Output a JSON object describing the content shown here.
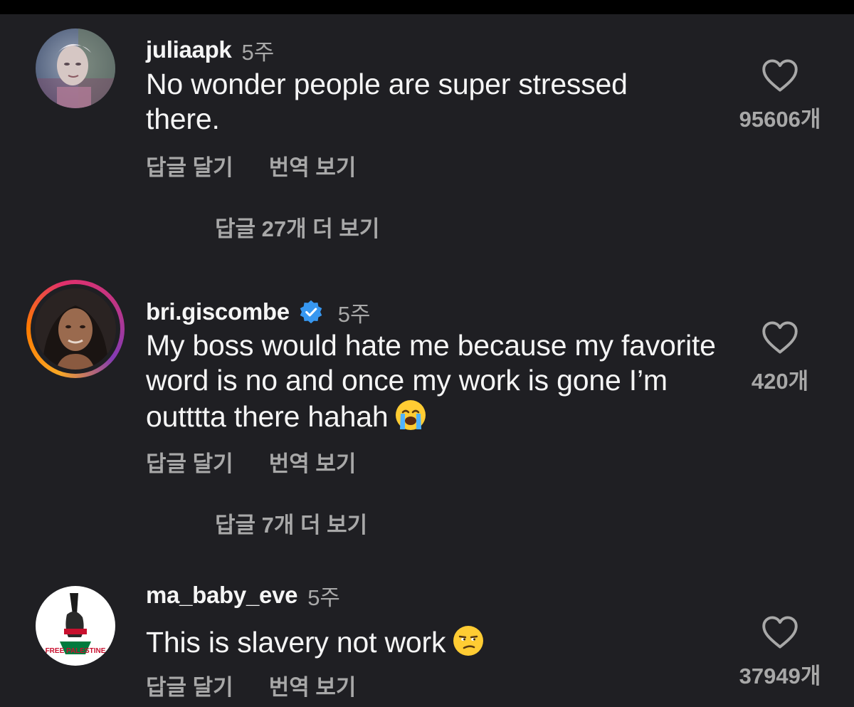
{
  "comments": [
    {
      "username": "juliaapk",
      "verified": false,
      "time": "5주",
      "text": "No wonder people are super stressed there.",
      "emoji": "",
      "reply_label": "답글 달기",
      "translate_label": "번역 보기",
      "like_count": "95606개",
      "more_replies": "답글 27개 더 보기"
    },
    {
      "username": "bri.giscombe",
      "verified": true,
      "time": "5주",
      "text": "My boss would hate me because my favorite word is no and once my work is gone I’m outttta there hahah",
      "emoji": "loudly-crying-face",
      "reply_label": "답글 달기",
      "translate_label": "번역 보기",
      "like_count": "420개",
      "more_replies": "답글 7개 더 보기"
    },
    {
      "username": "ma_baby_eve",
      "verified": false,
      "time": "5주",
      "text": "This is slavery not work",
      "emoji": "unamused-face",
      "reply_label": "답글 달기",
      "translate_label": "번역 보기",
      "like_count": "37949개",
      "avatar_text": "FREE PALESTINE"
    }
  ],
  "colors": {
    "background": "#1f1f23",
    "primary_text": "#f5f5f5",
    "secondary_text": "#a8a8a8",
    "verified_badge": "#3797f0",
    "story_ring": [
      "#f9a825",
      "#e1306c",
      "#833ab4"
    ]
  }
}
